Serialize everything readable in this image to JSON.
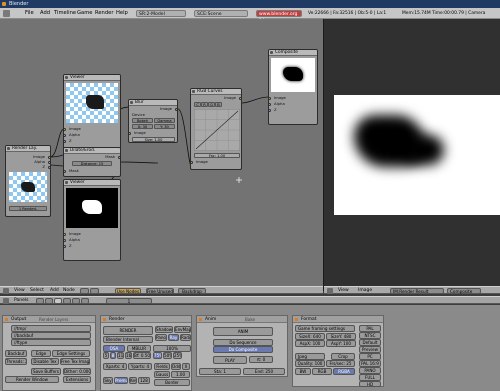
{
  "window": {
    "title": "Blender"
  },
  "menubar": {
    "items": [
      "File",
      "Add",
      "Timeline",
      "Game",
      "Render",
      "Help"
    ],
    "screen": "SR:2-Model",
    "scene": "SCE:Scene",
    "url": "www.blender.org 24",
    "stats": "Ve:22666 | Fa:32516 | Ob:5-0 | La:1",
    "mem": "Mem:15.74M",
    "time": "Time:00:00.79 | Camera"
  },
  "nodes": {
    "viewer1": {
      "title": "Viewer",
      "inputs": [
        "Image",
        "Alpha",
        "Z"
      ]
    },
    "render_layers": {
      "title": "Render Lay.",
      "outputs": [
        "Image",
        "Alpha",
        "Z"
      ],
      "layer": "1 RenderL"
    },
    "blur": {
      "title": "Blur",
      "device": "Device",
      "type": "Bokeh",
      "gamma": "Gamma",
      "x": "X: 30",
      "y": "Y: 30",
      "size": "Size: 1.00",
      "input": "Image",
      "output": "Image"
    },
    "dilate": {
      "title": "Dilate/Erod.",
      "output": "Mask",
      "distance": "Distance: 15",
      "input": "Mask"
    },
    "viewer2": {
      "title": "Viewer",
      "inputs": [
        "Image",
        "Alpha",
        "Z"
      ]
    },
    "rgb": {
      "title": "RGB Curves",
      "channels": [
        "C",
        "R",
        "G",
        "B"
      ],
      "fac": "Fac: 1.00",
      "input": "Image",
      "output": "Image"
    },
    "composite": {
      "title": "Composite",
      "inputs": [
        "Image",
        "Alpha",
        "Z"
      ]
    }
  },
  "node_header": {
    "items": [
      "View",
      "Select",
      "Add",
      "Node"
    ],
    "use_nodes": "Use Nodes",
    "free_unused": "Free Unused",
    "backdrop": "Backdrop"
  },
  "image_header": {
    "items": [
      "View",
      "Image"
    ],
    "image_name": "IM:Render Result",
    "channel": "Composite"
  },
  "buttons_header": {
    "panels": "Panels",
    "frame": "1"
  },
  "output_panel": {
    "tabs": [
      "Output",
      "Render Layers"
    ],
    "paths": [
      "//tmp/",
      "//backbuf",
      "//ftype"
    ],
    "backbuf": "Backbuf",
    "edge": "Edge",
    "edge_settings": "Edge Settings",
    "threads": "Threads: 2",
    "disable_tex": "Disable Tex",
    "free_tex": "Free Tex Imag",
    "save_buffers": "Save Buffers",
    "dither": "Dither: 0.000",
    "render_window": "Render Window",
    "extensions": "Extensions"
  },
  "render_panel": {
    "title": "Render",
    "render": "RENDER",
    "engine": "Blender Internal",
    "shadow": "Shadow",
    "envmap": "EnvMap",
    "pano": "Pano",
    "ray": "Ray",
    "radio": "Radio",
    "osa": "OSA",
    "mblur": "MBLUR",
    "osa_vals": [
      "5",
      "8",
      "11",
      "16"
    ],
    "bf": "Bf: 0.50",
    "pct": [
      "100%",
      "75%",
      "50%",
      "25%"
    ],
    "xparts": "Xparts: 4",
    "yparts": "Yparts: 4",
    "fields": "Fields",
    "odd": "Odd",
    "x": "X",
    "gauss": "Gauss",
    "size": "1.00",
    "sky": "Sky",
    "premul": "Premul",
    "key": "Key",
    "border": "Border",
    "gamma": "128"
  },
  "anim_panel": {
    "title": "Anim",
    "tab2": "Bake",
    "anim": "ANIM",
    "do_sequence": "Do Sequence",
    "do_composite": "Do Composite",
    "play": "PLAY",
    "rt": "rt: 0",
    "sta": "Sta: 1",
    "end": "End: 250"
  },
  "format_panel": {
    "title": "Format",
    "game_settings": "Game framing settings",
    "sizex": "SizeX: 640",
    "sizey": "SizeY: 480",
    "aspx": "AspX: 100",
    "aspy": "AspY: 100",
    "jpeg": "Jpeg",
    "crop": "Crop",
    "quality": "Quality: 100",
    "frs": "Frs/sec: 25",
    "bw": "BW",
    "rgb": "RGB",
    "rgba": "RGBA",
    "presets": [
      "PAL",
      "NTSC",
      "Default",
      "Preview",
      "PC",
      "PAL 16:9",
      "PANO",
      "FULL",
      "HD"
    ]
  }
}
